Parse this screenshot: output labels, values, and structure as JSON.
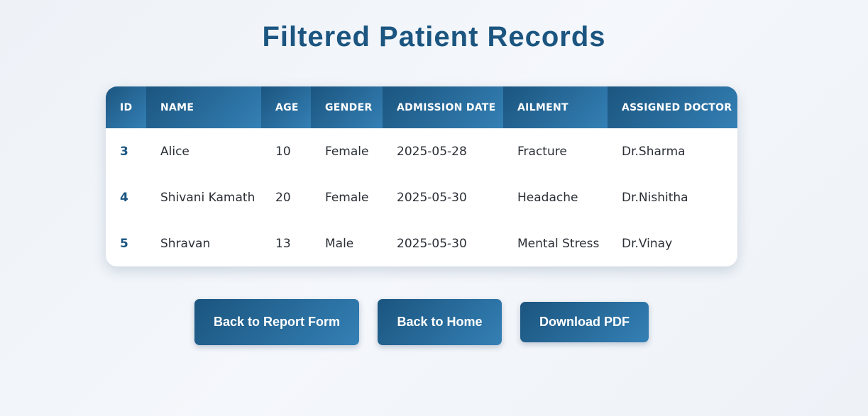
{
  "page": {
    "title": "Filtered Patient Records"
  },
  "table": {
    "headers": [
      "ID",
      "NAME",
      "AGE",
      "GENDER",
      "ADMISSION DATE",
      "AILMENT",
      "ASSIGNED DOCTOR"
    ],
    "rows": [
      [
        "3",
        "Alice",
        "10",
        "Female",
        "2025-05-28",
        "Fracture",
        "Dr.Sharma"
      ],
      [
        "4",
        "Shivani Kamath",
        "20",
        "Female",
        "2025-05-30",
        "Headache",
        "Dr.Nishitha"
      ],
      [
        "5",
        "Shravan",
        "13",
        "Male",
        "2025-05-30",
        "Mental Stress",
        "Dr.Vinay"
      ]
    ]
  },
  "actions": {
    "back_report_label": "Back to Report Form",
    "back_home_label": "Back to Home",
    "download_pdf_label": "Download PDF"
  },
  "colors": {
    "accent": "#1b5580",
    "header_gradient_start": "#1b557f",
    "header_gradient_end": "#3480b5"
  }
}
